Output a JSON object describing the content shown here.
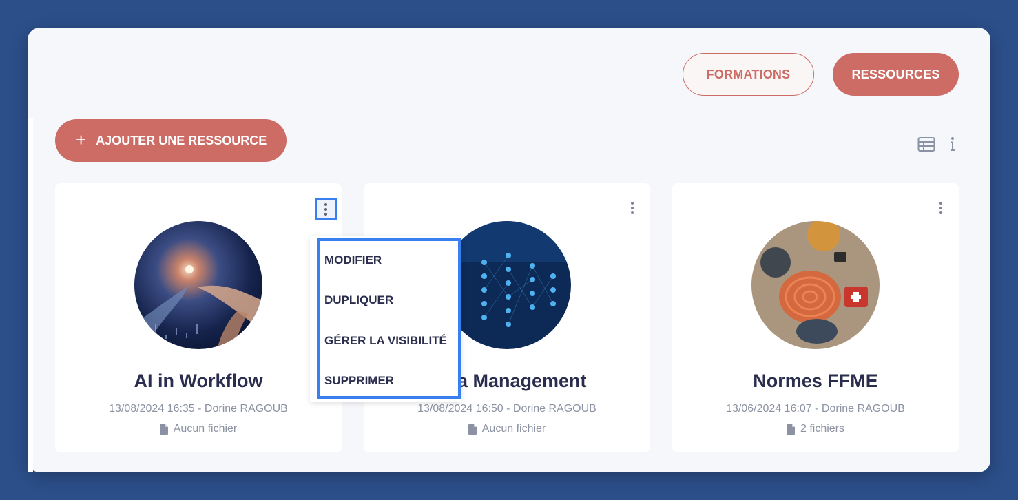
{
  "tabs": {
    "formations": "FORMATIONS",
    "ressources": "RESSOURCES"
  },
  "toolbar": {
    "add_label": "AJOUTER UNE RESSOURCE",
    "add_icon": "plus-icon",
    "view_icon": "table-view-icon",
    "info_icon": "info-icon"
  },
  "cards": [
    {
      "title": "AI in Workflow",
      "meta": "13/08/2024 16:35 - Dorine RAGOUB",
      "files": "Aucun fichier"
    },
    {
      "title": "Data Management",
      "meta": "13/08/2024 16:50 - Dorine RAGOUB",
      "files": "Aucun fichier"
    },
    {
      "title": "Normes FFME",
      "meta": "13/06/2024 16:07 - Dorine RAGOUB",
      "files": "2 fichiers"
    }
  ],
  "context_menu": {
    "items": [
      "MODIFIER",
      "DUPLIQUER",
      "GÉRER LA VISIBILITÉ",
      "SUPPRIMER"
    ]
  },
  "colors": {
    "background": "#2c4f8a",
    "accent": "#cd6b65",
    "highlight": "#3a7ff0",
    "title_text": "#2a2d4d"
  }
}
